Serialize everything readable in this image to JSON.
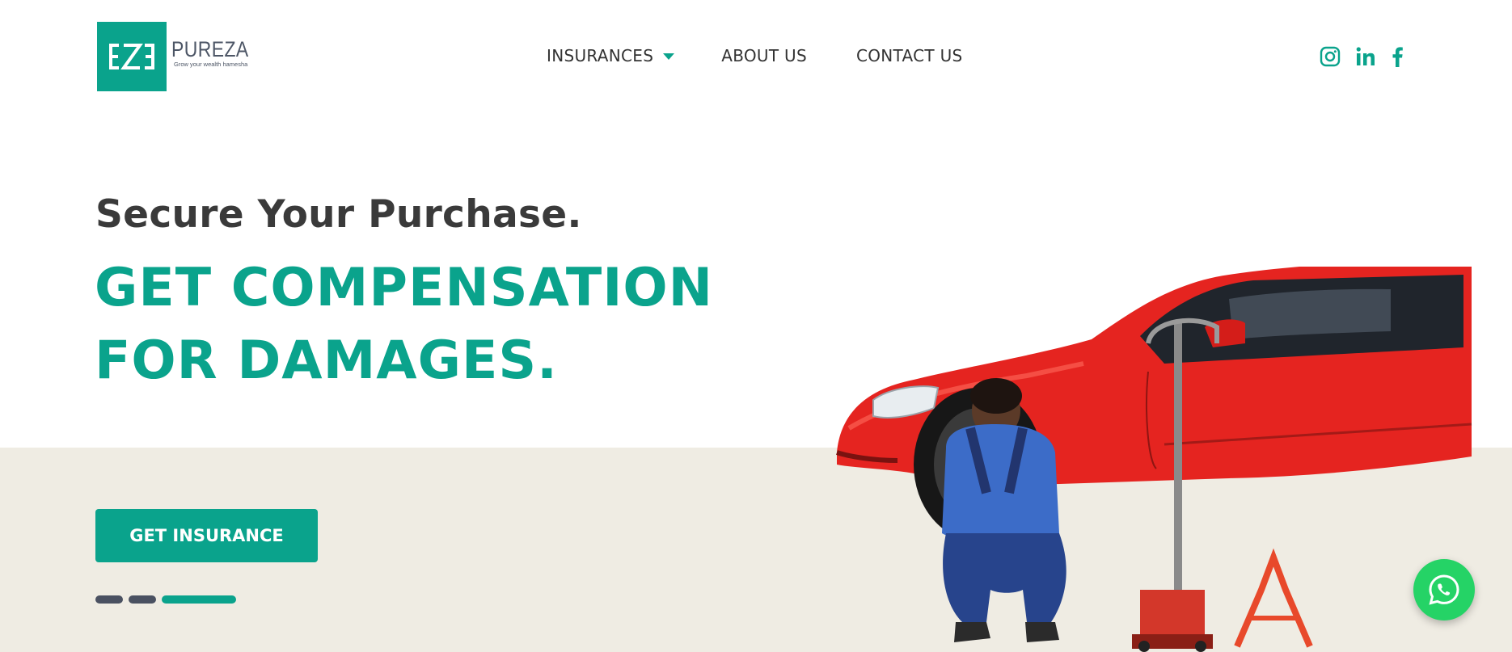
{
  "brand": {
    "name": "PUREZA",
    "tagline": "Grow your wealth hamesha"
  },
  "nav": {
    "items": [
      "INSURANCES",
      "ABOUT US",
      "CONTACT US"
    ]
  },
  "social": [
    "instagram-icon",
    "linkedin-icon",
    "facebook-icon"
  ],
  "hero": {
    "subtitle": "Secure Your Purchase.",
    "title_line1": "GET COMPENSATION",
    "title_line2": "FOR DAMAGES.",
    "cta": "GET INSURANCE",
    "slides_total": 3,
    "active_slide": 3
  },
  "colors": {
    "accent": "#0aa38c",
    "band": "#efece3",
    "dark": "#4a5161",
    "whatsapp": "#25d366"
  }
}
